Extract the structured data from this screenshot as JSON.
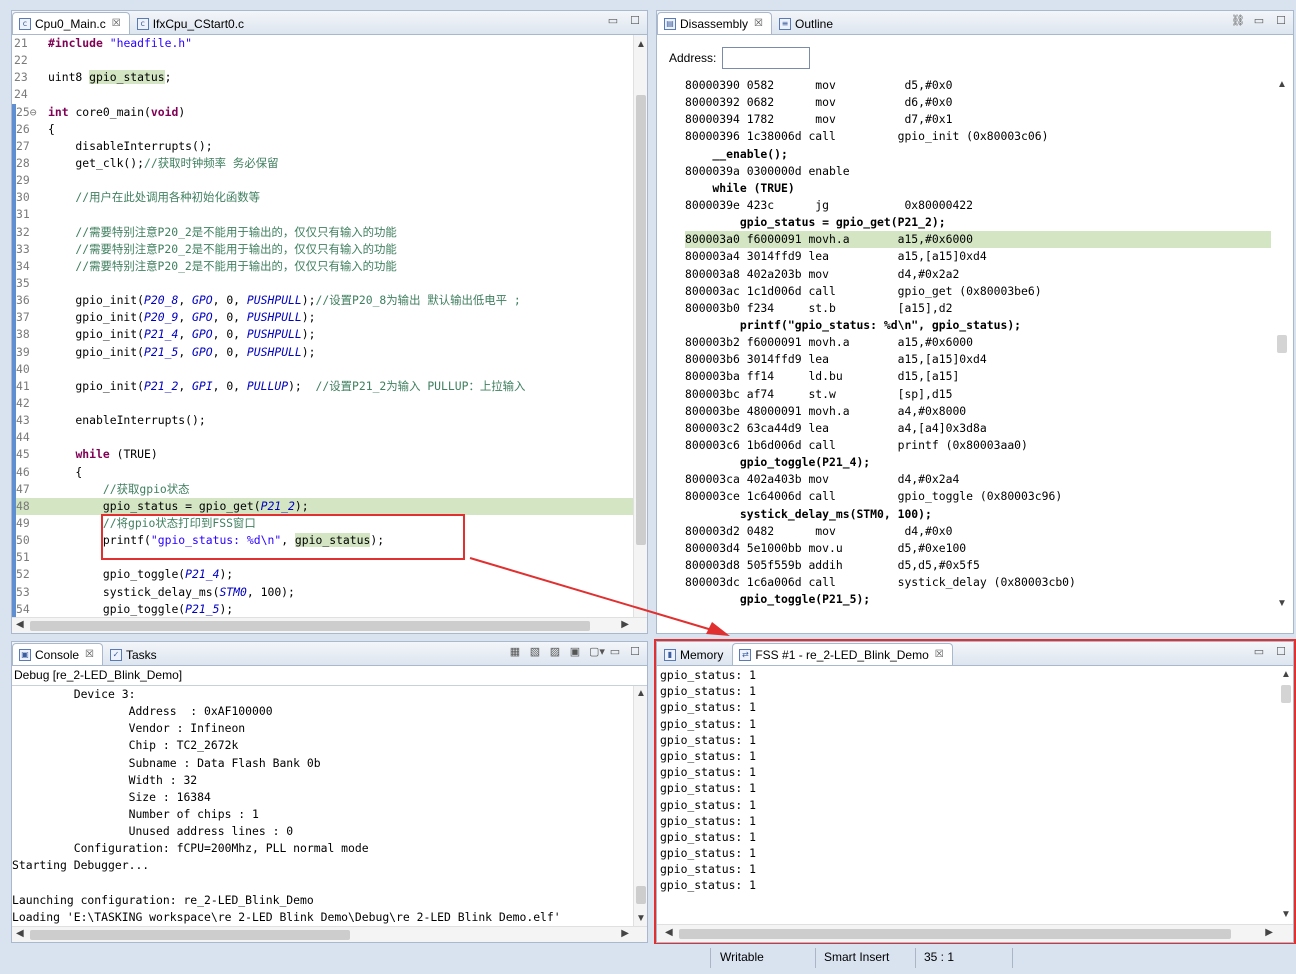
{
  "editor": {
    "tabs": [
      {
        "label": "Cpu0_Main.c",
        "close": "☒"
      },
      {
        "label": "IfxCpu_CStart0.c"
      }
    ],
    "lines": [
      {
        "n": "21",
        "bar": false,
        "hl": false,
        "parts": [
          {
            "t": "#include ",
            "c": "kw"
          },
          {
            "t": "\"headfile.h\"",
            "c": "str"
          }
        ]
      },
      {
        "n": "22",
        "bar": false,
        "hl": false,
        "parts": []
      },
      {
        "n": "23",
        "bar": false,
        "hl": false,
        "parts": [
          {
            "t": "uint8 ",
            "c": ""
          },
          {
            "t": "gpio_status",
            "c": "hl"
          },
          {
            "t": ";",
            "c": ""
          }
        ]
      },
      {
        "n": "24",
        "bar": false,
        "hl": false,
        "parts": []
      },
      {
        "n": "25⊖",
        "bar": true,
        "hl": false,
        "parts": [
          {
            "t": "int ",
            "c": "kw"
          },
          {
            "t": "core0_main(",
            "c": ""
          },
          {
            "t": "void",
            "c": "kw"
          },
          {
            "t": ")",
            "c": ""
          }
        ]
      },
      {
        "n": "26",
        "bar": true,
        "hl": false,
        "parts": [
          {
            "t": "{",
            "c": ""
          }
        ]
      },
      {
        "n": "27",
        "bar": true,
        "hl": false,
        "parts": [
          {
            "t": "    disableInterrupts();",
            "c": ""
          }
        ]
      },
      {
        "n": "28",
        "bar": true,
        "hl": false,
        "parts": [
          {
            "t": "    get_clk();",
            "c": ""
          },
          {
            "t": "//获取时钟频率 务必保留",
            "c": "cm"
          }
        ]
      },
      {
        "n": "29",
        "bar": true,
        "hl": false,
        "parts": []
      },
      {
        "n": "30",
        "bar": true,
        "hl": false,
        "parts": [
          {
            "t": "    //用户在此处调用各种初始化函数等",
            "c": "cm"
          }
        ]
      },
      {
        "n": "31",
        "bar": true,
        "hl": false,
        "parts": []
      },
      {
        "n": "32",
        "bar": true,
        "hl": false,
        "parts": [
          {
            "t": "    //需要特别注意P20_2是不能用于输出的，仅仅只有输入的功能",
            "c": "cm"
          }
        ]
      },
      {
        "n": "33",
        "bar": true,
        "hl": false,
        "parts": [
          {
            "t": "    //需要特别注意P20_2是不能用于输出的，仅仅只有输入的功能",
            "c": "cm"
          }
        ]
      },
      {
        "n": "34",
        "bar": true,
        "hl": false,
        "parts": [
          {
            "t": "    //需要特别注意P20_2是不能用于输出的，仅仅只有输入的功能",
            "c": "cm"
          }
        ]
      },
      {
        "n": "35",
        "bar": true,
        "hl": false,
        "parts": []
      },
      {
        "n": "36",
        "bar": true,
        "hl": false,
        "parts": [
          {
            "t": "    gpio_init(",
            "c": ""
          },
          {
            "t": "P20_8",
            "c": "it"
          },
          {
            "t": ", ",
            "c": ""
          },
          {
            "t": "GPO",
            "c": "it"
          },
          {
            "t": ", 0, ",
            "c": ""
          },
          {
            "t": "PUSHPULL",
            "c": "it"
          },
          {
            "t": ");",
            "c": ""
          },
          {
            "t": "//设置P20_8为输出 默认输出低电平 ;",
            "c": "cm"
          }
        ]
      },
      {
        "n": "37",
        "bar": true,
        "hl": false,
        "parts": [
          {
            "t": "    gpio_init(",
            "c": ""
          },
          {
            "t": "P20_9",
            "c": "it"
          },
          {
            "t": ", ",
            "c": ""
          },
          {
            "t": "GPO",
            "c": "it"
          },
          {
            "t": ", 0, ",
            "c": ""
          },
          {
            "t": "PUSHPULL",
            "c": "it"
          },
          {
            "t": ");",
            "c": ""
          }
        ]
      },
      {
        "n": "38",
        "bar": true,
        "hl": false,
        "parts": [
          {
            "t": "    gpio_init(",
            "c": ""
          },
          {
            "t": "P21_4",
            "c": "it"
          },
          {
            "t": ", ",
            "c": ""
          },
          {
            "t": "GPO",
            "c": "it"
          },
          {
            "t": ", 0, ",
            "c": ""
          },
          {
            "t": "PUSHPULL",
            "c": "it"
          },
          {
            "t": ");",
            "c": ""
          }
        ]
      },
      {
        "n": "39",
        "bar": true,
        "hl": false,
        "parts": [
          {
            "t": "    gpio_init(",
            "c": ""
          },
          {
            "t": "P21_5",
            "c": "it"
          },
          {
            "t": ", ",
            "c": ""
          },
          {
            "t": "GPO",
            "c": "it"
          },
          {
            "t": ", 0, ",
            "c": ""
          },
          {
            "t": "PUSHPULL",
            "c": "it"
          },
          {
            "t": ");",
            "c": ""
          }
        ]
      },
      {
        "n": "40",
        "bar": true,
        "hl": false,
        "parts": []
      },
      {
        "n": "41",
        "bar": true,
        "hl": false,
        "parts": [
          {
            "t": "    gpio_init(",
            "c": ""
          },
          {
            "t": "P21_2",
            "c": "it"
          },
          {
            "t": ", ",
            "c": ""
          },
          {
            "t": "GPI",
            "c": "it"
          },
          {
            "t": ", 0, ",
            "c": ""
          },
          {
            "t": "PULLUP",
            "c": "it"
          },
          {
            "t": ");  ",
            "c": ""
          },
          {
            "t": "//设置P21_2为输入 PULLUP：上拉输入",
            "c": "cm"
          }
        ]
      },
      {
        "n": "42",
        "bar": true,
        "hl": false,
        "parts": []
      },
      {
        "n": "43",
        "bar": true,
        "hl": false,
        "parts": [
          {
            "t": "    enableInterrupts();",
            "c": ""
          }
        ]
      },
      {
        "n": "44",
        "bar": true,
        "hl": false,
        "parts": []
      },
      {
        "n": "45",
        "bar": true,
        "hl": false,
        "parts": [
          {
            "t": "    ",
            "c": ""
          },
          {
            "t": "while",
            "c": "kw"
          },
          {
            "t": " (",
            "c": ""
          },
          {
            "t": "TRUE",
            "c": ""
          },
          {
            "t": ")",
            "c": ""
          }
        ]
      },
      {
        "n": "46",
        "bar": true,
        "hl": false,
        "parts": [
          {
            "t": "    {",
            "c": ""
          }
        ]
      },
      {
        "n": "47",
        "bar": true,
        "hl": false,
        "parts": [
          {
            "t": "        //获取gpio状态",
            "c": "cm"
          }
        ]
      },
      {
        "n": "48",
        "bar": true,
        "hl": true,
        "parts": [
          {
            "t": "        gpio_status = gpio_get(",
            "c": ""
          },
          {
            "t": "P21_2",
            "c": "it"
          },
          {
            "t": ");",
            "c": ""
          }
        ]
      },
      {
        "n": "49",
        "bar": true,
        "hl": false,
        "parts": [
          {
            "t": "        //将gpio状态打印到FSS窗口",
            "c": "cm"
          }
        ]
      },
      {
        "n": "50",
        "bar": true,
        "hl": false,
        "parts": [
          {
            "t": "        printf(",
            "c": ""
          },
          {
            "t": "\"gpio_status: %d\\n\"",
            "c": "str"
          },
          {
            "t": ", ",
            "c": ""
          },
          {
            "t": "gpio_status",
            "c": "hl"
          },
          {
            "t": ");",
            "c": ""
          }
        ]
      },
      {
        "n": "51",
        "bar": true,
        "hl": false,
        "parts": []
      },
      {
        "n": "52",
        "bar": true,
        "hl": false,
        "parts": [
          {
            "t": "        gpio_toggle(",
            "c": ""
          },
          {
            "t": "P21_4",
            "c": "it"
          },
          {
            "t": ");",
            "c": ""
          }
        ]
      },
      {
        "n": "53",
        "bar": true,
        "hl": false,
        "parts": [
          {
            "t": "        systick_delay_ms(",
            "c": ""
          },
          {
            "t": "STM0",
            "c": "it"
          },
          {
            "t": ", 100);",
            "c": ""
          }
        ]
      },
      {
        "n": "54",
        "bar": true,
        "hl": false,
        "parts": [
          {
            "t": "        gpio_toggle(",
            "c": ""
          },
          {
            "t": "P21_5",
            "c": "it"
          },
          {
            "t": ");",
            "c": ""
          }
        ]
      }
    ]
  },
  "disassembly": {
    "tabs": [
      {
        "label": "Disassembly",
        "close": "☒"
      },
      {
        "label": "Outline"
      }
    ],
    "address_label": "Address:",
    "address_value": "",
    "lines": [
      {
        "src": false,
        "hl": false,
        "t": "80000390 0582      mov          d5,#0x0"
      },
      {
        "src": false,
        "hl": false,
        "t": "80000392 0682      mov          d6,#0x0"
      },
      {
        "src": false,
        "hl": false,
        "t": "80000394 1782      mov          d7,#0x1"
      },
      {
        "src": false,
        "hl": false,
        "t": "80000396 1c38006d call         gpio_init (0x80003c06)"
      },
      {
        "src": true,
        "hl": false,
        "t": "    __enable();"
      },
      {
        "src": false,
        "hl": false,
        "t": "8000039a 0300000d enable"
      },
      {
        "src": true,
        "hl": false,
        "t": "    while (TRUE)"
      },
      {
        "src": false,
        "hl": false,
        "t": "8000039e 423c      jg           0x80000422"
      },
      {
        "src": true,
        "hl": false,
        "t": "        gpio_status = gpio_get(P21_2);"
      },
      {
        "src": false,
        "hl": true,
        "t": "800003a0 f6000091 movh.a       a15,#0x6000"
      },
      {
        "src": false,
        "hl": false,
        "t": "800003a4 3014ffd9 lea          a15,[a15]0xd4"
      },
      {
        "src": false,
        "hl": false,
        "t": "800003a8 402a203b mov          d4,#0x2a2"
      },
      {
        "src": false,
        "hl": false,
        "t": "800003ac 1c1d006d call         gpio_get (0x80003be6)"
      },
      {
        "src": false,
        "hl": false,
        "t": "800003b0 f234     st.b         [a15],d2"
      },
      {
        "src": true,
        "hl": false,
        "t": "        printf(\"gpio_status: %d\\n\", gpio_status);"
      },
      {
        "src": false,
        "hl": false,
        "t": "800003b2 f6000091 movh.a       a15,#0x6000"
      },
      {
        "src": false,
        "hl": false,
        "t": "800003b6 3014ffd9 lea          a15,[a15]0xd4"
      },
      {
        "src": false,
        "hl": false,
        "t": "800003ba ff14     ld.bu        d15,[a15]"
      },
      {
        "src": false,
        "hl": false,
        "t": "800003bc af74     st.w         [sp],d15"
      },
      {
        "src": false,
        "hl": false,
        "t": "800003be 48000091 movh.a       a4,#0x8000"
      },
      {
        "src": false,
        "hl": false,
        "t": "800003c2 63ca44d9 lea          a4,[a4]0x3d8a"
      },
      {
        "src": false,
        "hl": false,
        "t": "800003c6 1b6d006d call         printf (0x80003aa0)"
      },
      {
        "src": true,
        "hl": false,
        "t": "        gpio_toggle(P21_4);"
      },
      {
        "src": false,
        "hl": false,
        "t": "800003ca 402a403b mov          d4,#0x2a4"
      },
      {
        "src": false,
        "hl": false,
        "t": "800003ce 1c64006d call         gpio_toggle (0x80003c96)"
      },
      {
        "src": true,
        "hl": false,
        "t": "        systick_delay_ms(STM0, 100);"
      },
      {
        "src": false,
        "hl": false,
        "t": "800003d2 0482      mov          d4,#0x0"
      },
      {
        "src": false,
        "hl": false,
        "t": "800003d4 5e1000bb mov.u        d5,#0xe100"
      },
      {
        "src": false,
        "hl": false,
        "t": "800003d8 505f559b addih        d5,d5,#0x5f5"
      },
      {
        "src": false,
        "hl": false,
        "t": "800003dc 1c6a006d call         systick_delay (0x80003cb0)"
      },
      {
        "src": true,
        "hl": false,
        "t": "        gpio_toggle(P21_5);"
      }
    ]
  },
  "console": {
    "tabs": [
      {
        "label": "Console",
        "close": "☒"
      },
      {
        "label": "Tasks"
      }
    ],
    "title": "Debug [re_2-LED_Blink_Demo]",
    "lines": [
      "         Device 3:",
      "                 Address  : 0xAF100000",
      "                 Vendor : Infineon",
      "                 Chip : TC2_2672k",
      "                 Subname : Data Flash Bank 0b",
      "                 Width : 32",
      "                 Size : 16384",
      "                 Number of chips : 1",
      "                 Unused address lines : 0",
      "         Configuration: fCPU=200Mhz, PLL normal mode",
      "Starting Debugger...",
      "",
      "Launching configuration: re_2-LED_Blink_Demo",
      "Loading 'E:\\TASKING workspace\\re 2-LED Blink Demo\\Debug\\re 2-LED Blink Demo.elf'"
    ]
  },
  "fss": {
    "tabs": [
      {
        "label": "Memory"
      },
      {
        "label": "FSS #1 - re_2-LED_Blink_Demo",
        "close": "☒"
      }
    ],
    "lines": [
      "gpio_status: 1",
      "gpio_status: 1",
      "gpio_status: 1",
      "gpio_status: 1",
      "gpio_status: 1",
      "gpio_status: 1",
      "gpio_status: 1",
      "gpio_status: 1",
      "gpio_status: 1",
      "gpio_status: 1",
      "gpio_status: 1",
      "gpio_status: 1",
      "gpio_status: 1",
      "gpio_status: 1"
    ]
  },
  "statusbar": {
    "writable": "Writable",
    "insert_mode": "Smart Insert",
    "position": "35 : 1"
  },
  "colors": {
    "highlight_line": "#d3e5c3",
    "annotation_red": "#e03030"
  }
}
